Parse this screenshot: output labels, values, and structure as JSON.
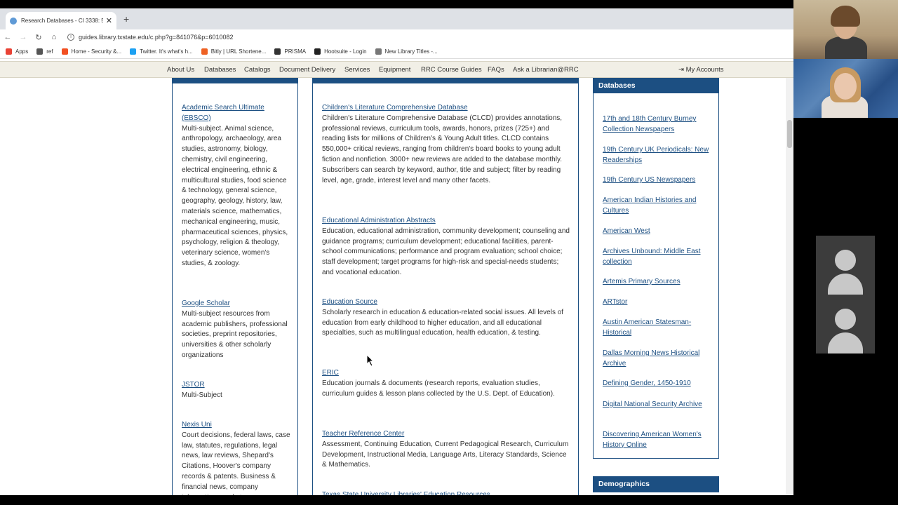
{
  "browser": {
    "tab_title": "Research Databases - CI 3338: 5...",
    "url": "guides.library.txstate.edu/c.php?g=841076&p=6010082",
    "bookmarks": [
      {
        "label": "Apps",
        "color": "#e94235"
      },
      {
        "label": "ref",
        "color": "#555555"
      },
      {
        "label": "Home - Security &...",
        "color": "#f25022"
      },
      {
        "label": "Twitter. It's what's h...",
        "color": "#1da1f2"
      },
      {
        "label": "Bitly | URL Shortene...",
        "color": "#ee6123"
      },
      {
        "label": "PRISMA",
        "color": "#333333"
      },
      {
        "label": "Hootsuite - Login",
        "color": "#222222"
      },
      {
        "label": "New Library Titles -...",
        "color": "#777777"
      }
    ]
  },
  "site_nav": {
    "items": [
      "About Us",
      "Databases",
      "Catalogs",
      "Document Delivery",
      "Services",
      "Equipment",
      "RRC Course Guides",
      "FAQs",
      "Ask a Librarian@RRC"
    ],
    "account": "My Accounts"
  },
  "left_column": [
    {
      "title": "Academic Search Ultimate (EBSCO)",
      "desc": "Multi-subject. Animal science, anthropology, archaeology, area studies, astronomy, biology, chemistry, civil engineering, electrical engineering, ethnic & multicultural studies, food science & technology, general science, geography, geology, history, law, materials science, mathematics, mechanical engineering, music, pharmaceutical sciences, physics, psychology, religion & theology, veterinary science, women's studies, & zoology."
    },
    {
      "title": "Google Scholar",
      "desc": "Multi-subject resources from academic publishers, professional societies, preprint repositories, universities & other scholarly organizations"
    },
    {
      "title": "JSTOR",
      "desc": "Multi-Subject"
    },
    {
      "title": "Nexis Uni",
      "desc": "Court decisions, federal laws, case law, statutes, regulations, legal news, law reviews, Shepard's Citations, Hoover's company records & patents. Business & financial news, company information, market"
    }
  ],
  "middle_column": [
    {
      "title": "Children's Literature Comprehensive Database",
      "desc": "Children's Literature Comprehensive Database (CLCD) provides annotations, professional reviews, curriculum tools, awards, honors, prizes (725+) and reading lists for millions of Children's & Young Adult titles. CLCD contains 550,000+ critical reviews, ranging from children's board books to young adult fiction and nonfiction. 3000+ new reviews are added to the database monthly. Subscribers can search by keyword, author, title and subject; filter by reading level, age, grade, interest level and many other facets."
    },
    {
      "title": "Educational Administration Abstracts",
      "desc": "Education, educational administration, community development; counseling and guidance programs; curriculum development; educational facilities, parent-school communications; performance and program evaluation; school choice; staff development; target programs for high-risk and special-needs students; and vocational education."
    },
    {
      "title": "Education Source",
      "desc": "Scholarly research in education & education-related social issues. All levels of education from early childhood to higher education, and all educational specialties, such as multilingual education, health education, & testing."
    },
    {
      "title": "ERIC",
      "desc": "Education journals & documents (research reports, evaluation studies, curriculum guides & lesson plans collected by the U.S. Dept. of Education)."
    },
    {
      "title": "Teacher Reference Center",
      "desc": "Assessment, Continuing Education, Current Pedagogical Research, Curriculum Development, Instructional Media, Language Arts, Literacy Standards, Science & Mathematics."
    },
    {
      "title": "Texas State University Libraries' Education Resources",
      "desc": ""
    }
  ],
  "databases_panel": {
    "heading": "Databases",
    "links": [
      "17th and 18th Century Burney Collection Newspapers",
      "19th Century UK Periodicals: New Readerships",
      "19th Century US Newspapers",
      "American Indian Histories and Cultures",
      "American West",
      "Archives Unbound: Middle East collection",
      "Artemis Primary Sources",
      "ARTstor",
      "Austin American Statesman-Historical",
      "Dallas Morning News Historical Archive",
      "Defining Gender, 1450-1910",
      "Digital National Security Archive",
      "Discovering American Women's History Online"
    ]
  },
  "demographics_heading": "Demographics",
  "colors": {
    "brand": "#1c4f82",
    "link": "#1c4f82",
    "nav_bg": "#f1efe6"
  }
}
